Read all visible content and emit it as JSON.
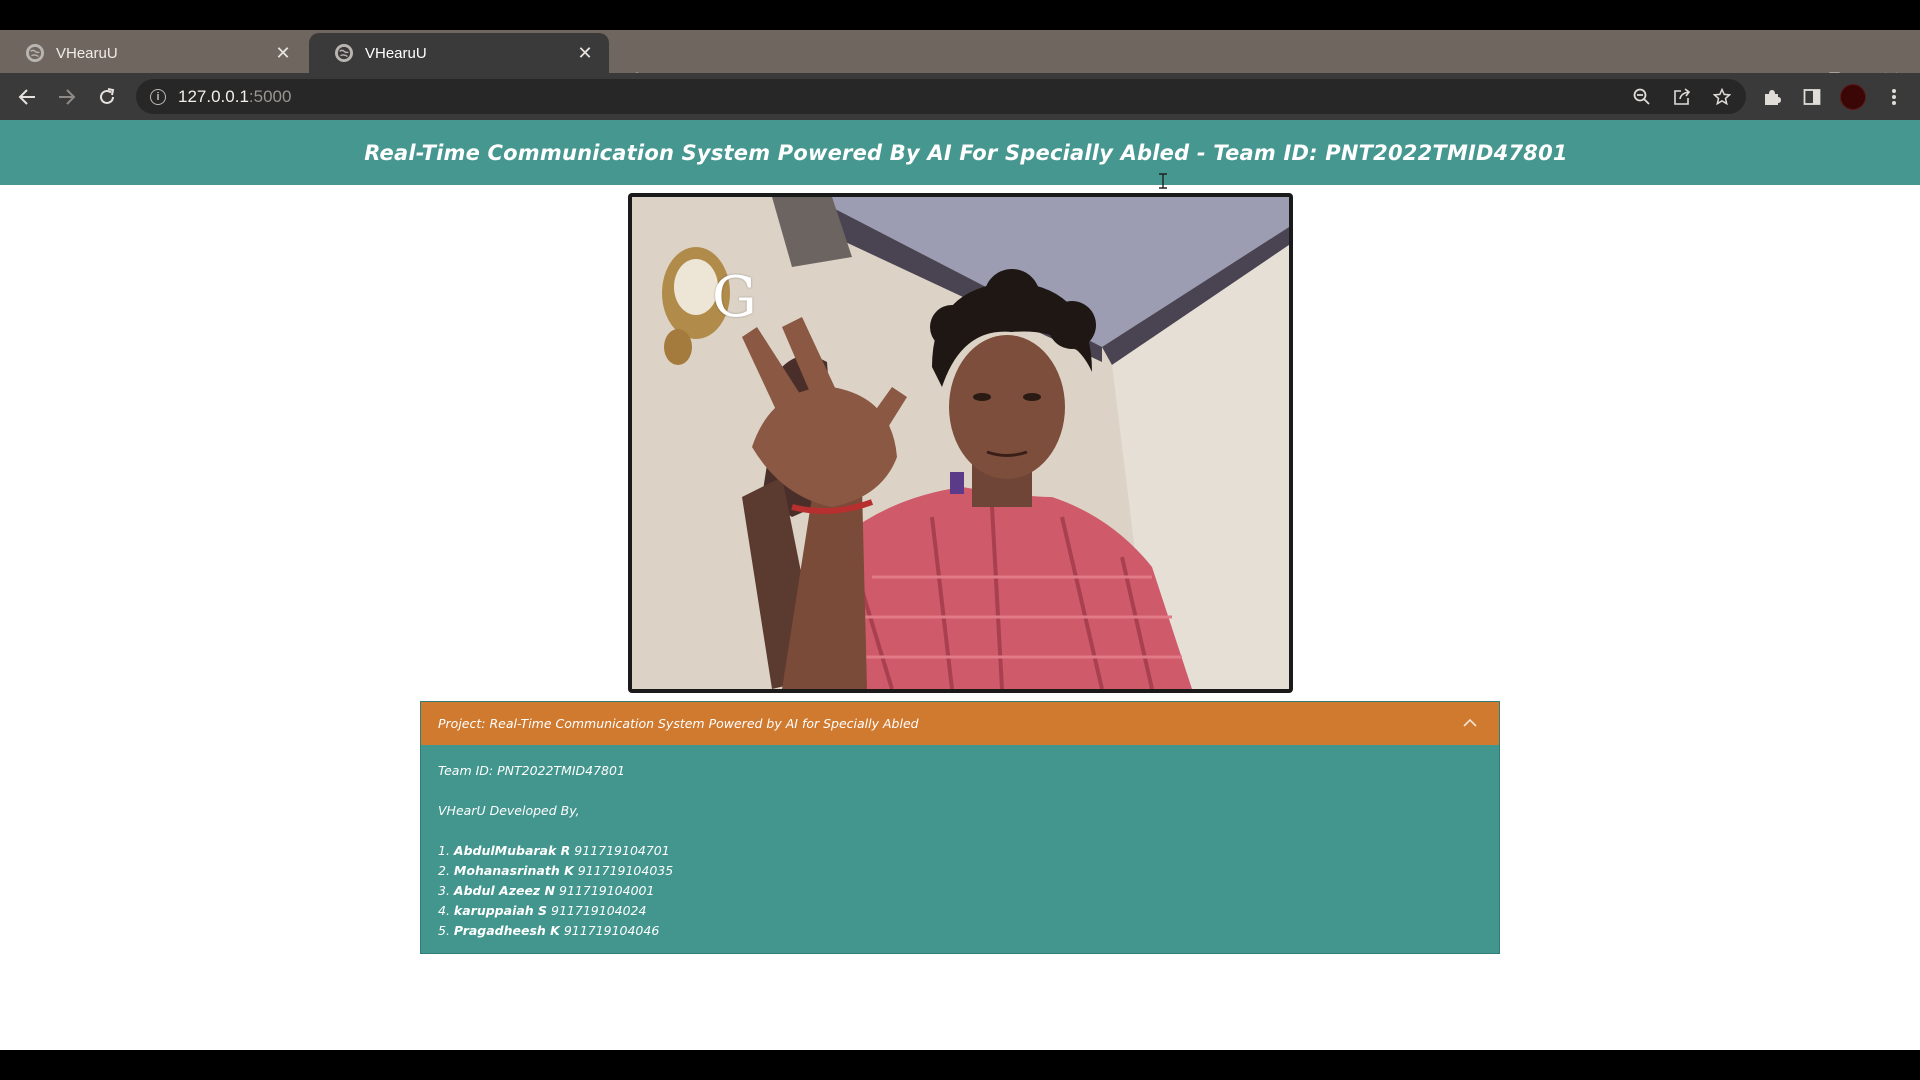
{
  "browser": {
    "tabs": [
      {
        "label": "VHearuU",
        "active": false
      },
      {
        "label": "VHearuU",
        "active": true
      }
    ],
    "new_tab_symbol": "+",
    "address": {
      "host": "127.0.0.1",
      "port": ":5000"
    },
    "toolbar_icons": [
      "zoom-out-icon",
      "share-icon",
      "bookmark-star-icon",
      "extensions-icon",
      "side-panel-icon",
      "profile-avatar",
      "menu-icon"
    ]
  },
  "page": {
    "header_title": "Real-Time Communication System Powered By AI For Specially Abled - Team ID: PNT2022TMID47801",
    "video": {
      "predicted_letter": "G"
    },
    "accordion": {
      "header": "Project: Real-Time Communication System Powered by AI for Specially Abled",
      "team_id": "Team ID: PNT2022TMID47801",
      "developed_by": "VHearU Developed By,",
      "members": [
        {
          "index": "1.",
          "name": "AbdulMubarak R",
          "roll": "911719104701"
        },
        {
          "index": "2.",
          "name": "Mohanasrinath K",
          "roll": "911719104035"
        },
        {
          "index": "3.",
          "name": "Abdul Azeez N",
          "roll": "911719104001"
        },
        {
          "index": "4.",
          "name": "karuppaiah S",
          "roll": "911719104024"
        },
        {
          "index": "5.",
          "name": "Pragadheesh K",
          "roll": "911719104046"
        }
      ]
    }
  },
  "colors": {
    "header_teal": "#46978f",
    "accordion_orange": "#d07a30",
    "accordion_body_teal": "#43968e"
  }
}
